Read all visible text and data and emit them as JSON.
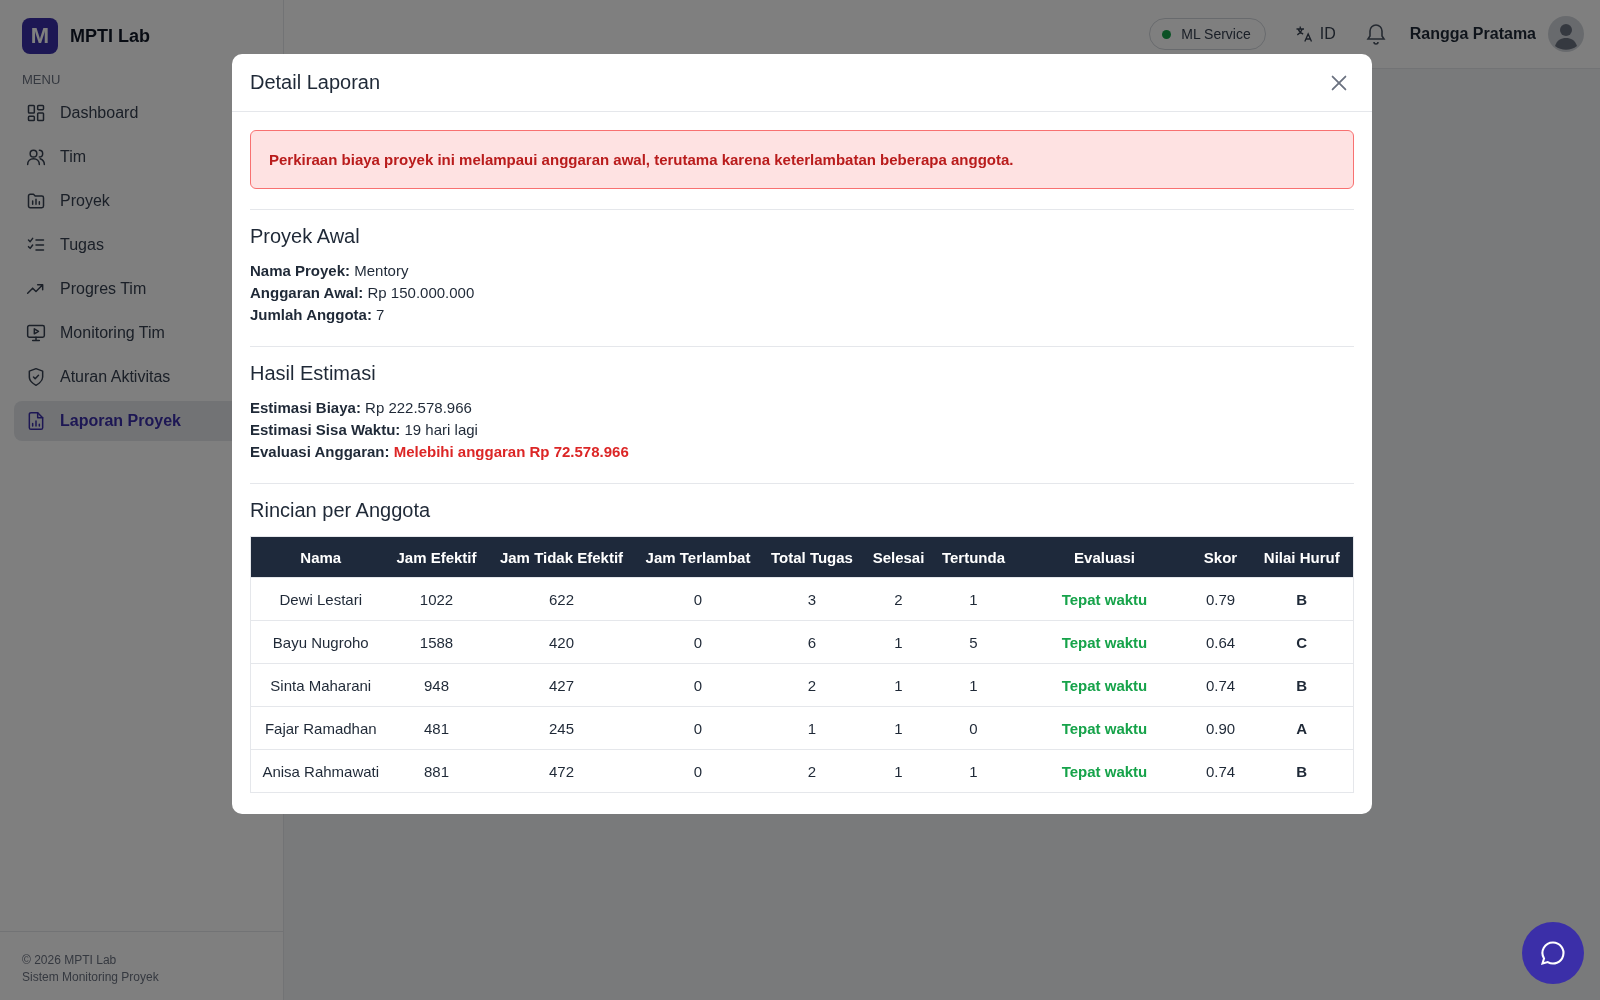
{
  "sidebar": {
    "brand": "MPTI Lab",
    "logo_letter": "M",
    "menu_label": "MENU",
    "items": [
      {
        "label": "Dashboard",
        "selected": false
      },
      {
        "label": "Tim",
        "selected": false
      },
      {
        "label": "Proyek",
        "selected": false
      },
      {
        "label": "Tugas",
        "selected": false
      },
      {
        "label": "Progres Tim",
        "selected": false
      },
      {
        "label": "Monitoring Tim",
        "selected": false
      },
      {
        "label": "Aturan Aktivitas",
        "selected": false
      },
      {
        "label": "Laporan Proyek",
        "selected": true
      }
    ],
    "footer": [
      "© 2026 MPTI Lab",
      "Sistem Monitoring Proyek"
    ]
  },
  "header": {
    "service": {
      "label": "ML Service"
    },
    "language": "ID",
    "user": "Rangga Pratama"
  },
  "modal": {
    "title": "Detail Laporan",
    "alert": "Perkiraan biaya proyek ini melampaui anggaran awal, terutama karena keterlambatan beberapa anggota.",
    "project": {
      "heading": "Proyek Awal",
      "fields": [
        {
          "label": "Nama Proyek:",
          "value": "Mentory"
        },
        {
          "label": "Anggaran Awal:",
          "value": "Rp 150.000.000"
        },
        {
          "label": "Jumlah Anggota:",
          "value": "7"
        }
      ]
    },
    "estimate": {
      "heading": "Hasil Estimasi",
      "fields": [
        {
          "label": "Estimasi Biaya:",
          "value": "Rp 222.578.966",
          "warning": false
        },
        {
          "label": "Estimasi Sisa Waktu:",
          "value": "19 hari lagi",
          "warning": false
        },
        {
          "label": "Evaluasi Anggaran:",
          "value": "Melebihi anggaran Rp 72.578.966",
          "warning": true
        }
      ]
    },
    "members": {
      "heading": "Rincian per Anggota",
      "columns": [
        "Nama",
        "Jam Efektif",
        "Jam Tidak Efektif",
        "Jam Terlambat",
        "Total Tugas",
        "Selesai",
        "Tertunda",
        "Evaluasi",
        "Skor",
        "Nilai Huruf"
      ],
      "rows": [
        {
          "cells": [
            "Dewi Lestari",
            "1022",
            "622",
            "0",
            "3",
            "2",
            "1"
          ],
          "evaluation": "Tepat waktu",
          "late": false,
          "score": "0.79",
          "grade": "B"
        },
        {
          "cells": [
            "Bayu Nugroho",
            "1588",
            "420",
            "0",
            "6",
            "1",
            "5"
          ],
          "evaluation": "Tepat waktu",
          "late": false,
          "score": "0.64",
          "grade": "C"
        },
        {
          "cells": [
            "Sinta Maharani",
            "948",
            "427",
            "0",
            "2",
            "1",
            "1"
          ],
          "evaluation": "Tepat waktu",
          "late": false,
          "score": "0.74",
          "grade": "B"
        },
        {
          "cells": [
            "Fajar Ramadhan",
            "481",
            "245",
            "0",
            "1",
            "1",
            "0"
          ],
          "evaluation": "Tepat waktu",
          "late": false,
          "score": "0.90",
          "grade": "A"
        },
        {
          "cells": [
            "Anisa Rahmawati",
            "881",
            "472",
            "0",
            "2",
            "1",
            "1"
          ],
          "evaluation": "Tepat waktu",
          "late": false,
          "score": "0.74",
          "grade": "B"
        }
      ]
    }
  }
}
